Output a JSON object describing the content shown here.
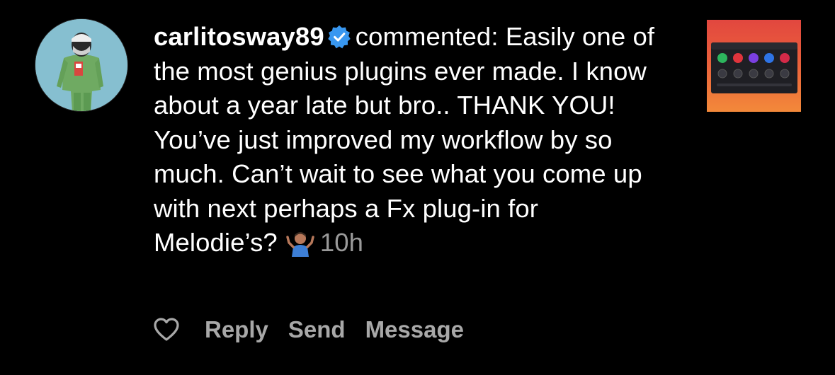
{
  "comment": {
    "username": "carlitosway89",
    "verified": true,
    "action_text": "commented:",
    "body": "Easily one of the most genius plugins ever made. I know about a year late but bro.. THANK YOU! You’ve just improved my workflow by so much. Can’t wait to see what you come up with next perhaps a Fx plug-in for Melodie’s?",
    "emoji": "🤷🏽‍♂️",
    "time": "10h"
  },
  "actions": {
    "like_icon": "heart-icon",
    "reply": "Reply",
    "send": "Send",
    "message": "Message"
  },
  "colors": {
    "background": "#000000",
    "text": "#ffffff",
    "muted": "#a8a8a8",
    "verified_badge": "#3897f0"
  }
}
